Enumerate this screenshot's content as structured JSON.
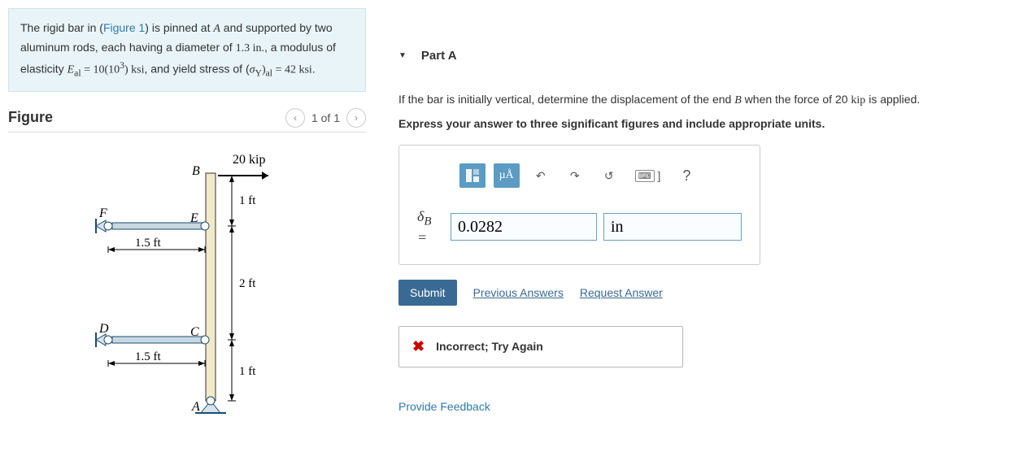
{
  "problem": {
    "pre_text": "The rigid bar in (",
    "figure_link": "Figure 1",
    "post_text_1": ") is pinned at ",
    "italic_A": "A",
    "post_text_2": " and supported by two aluminum rods, each having a diameter of ",
    "val_diam": "1.3 in.",
    "post_text_3": ", a modulus of elasticity ",
    "E_sym": "E",
    "E_sub": "al",
    "eq1": " = 10(10",
    "sup3": "3",
    "eq1b": ") ksi",
    "post_text_4": ", and yield stress of (",
    "sigma_sym": "σ",
    "Y_sub": "Y",
    "paren_al": ")",
    "al_sub": "al",
    "eq2": " = 42 ksi",
    "period": "."
  },
  "figure": {
    "title": "Figure",
    "pager_text": "1 of 1",
    "labels": {
      "load": "20 kip",
      "B": "B",
      "F": "F",
      "E": "E",
      "D": "D",
      "C": "C",
      "A": "A",
      "d1ft_top": "1 ft",
      "d2ft": "2 ft",
      "d1ft_bot": "1 ft",
      "d15ft": "1.5 ft"
    }
  },
  "part": {
    "title": "Part A",
    "question_pre": "If the bar is initially vertical, determine the displacement of the end ",
    "question_B": "B",
    "question_post": " when the force of 20 ",
    "question_unit": "kip",
    "question_end": " is applied.",
    "instructions": "Express your answer to three significant figures and include appropriate units."
  },
  "toolbar": {
    "units_label": "µÅ",
    "help_label": "?"
  },
  "answer": {
    "symbol": "δ",
    "subscript": "B",
    "equals_sign": " = ",
    "value": "0.0282",
    "unit": "in"
  },
  "actions": {
    "submit": "Submit",
    "previous": "Previous Answers",
    "request": "Request Answer"
  },
  "feedback": {
    "text": "Incorrect; Try Again"
  },
  "footer": {
    "provide_feedback": "Provide Feedback"
  }
}
